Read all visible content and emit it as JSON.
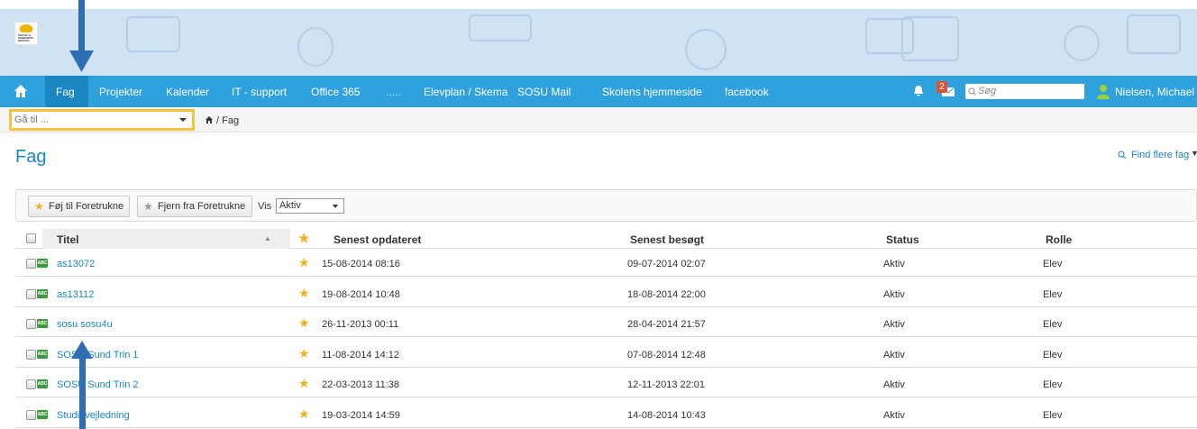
{
  "logo": {
    "text": "SOCIAL & SUNDHEDS SKOLEN"
  },
  "nav": {
    "items": [
      "Fag",
      "Projekter",
      "Kalender",
      "IT - support",
      "Office 365",
      ".....",
      "Elevplan / Skema",
      "SOSU Mail",
      "Skolens hjemmeside",
      "facebook"
    ],
    "active": "Fag",
    "badge": "2",
    "search_placeholder": "Søg",
    "user": "Nielsen, Michael"
  },
  "goto": {
    "placeholder": "Gå til ..."
  },
  "breadcrumb": "/ Fag",
  "page_title": "Fag",
  "find_more": "Find flere fag",
  "toolbar": {
    "add_fav": "Føj til Foretrukne",
    "remove_fav": "Fjern fra Foretrukne",
    "show_label": "Vis",
    "show_value": "Aktiv"
  },
  "table": {
    "headers": {
      "title": "Titel",
      "updated": "Senest opdateret",
      "visited": "Senest besøgt",
      "status": "Status",
      "role": "Rolle"
    },
    "rows": [
      {
        "title": "as13072",
        "updated": "15-08-2014 08:16",
        "visited": "09-07-2014 02:07",
        "status": "Aktiv",
        "role": "Elev"
      },
      {
        "title": "as13112",
        "updated": "19-08-2014 10:48",
        "visited": "18-08-2014 22:00",
        "status": "Aktiv",
        "role": "Elev"
      },
      {
        "title": "sosu sosu4u",
        "updated": "26-11-2013 00:11",
        "visited": "28-04-2014 21:57",
        "status": "Aktiv",
        "role": "Elev"
      },
      {
        "title": "SOSU Sund Trin 1",
        "updated": "11-08-2014 14:12",
        "visited": "07-08-2014 12:48",
        "status": "Aktiv",
        "role": "Elev"
      },
      {
        "title": "SOSU Sund Trin 2",
        "updated": "22-03-2013 11:38",
        "visited": "12-11-2013 22:01",
        "status": "Aktiv",
        "role": "Elev"
      },
      {
        "title": "Studievejledning",
        "updated": "19-03-2014 14:59",
        "visited": "14-08-2014 10:43",
        "status": "Aktiv",
        "role": "Elev"
      }
    ]
  },
  "icons": {
    "home": "home-icon",
    "bell": "bell-icon",
    "messages": "messages-icon",
    "user": "user-icon",
    "star": "star-icon",
    "course": "course-icon"
  },
  "colors": {
    "nav": "#2fa1dc",
    "nav_active": "#1b87c2",
    "link": "#1b87c2",
    "star": "#f2b01e",
    "banner": "#cfe3f3",
    "badge": "#e0512f",
    "goto_border": "#f5c242"
  }
}
